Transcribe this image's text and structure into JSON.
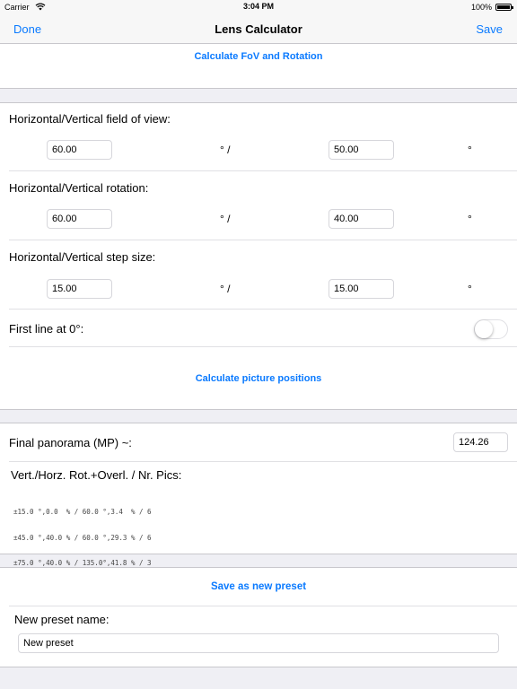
{
  "status": {
    "carrier": "Carrier",
    "time": "3:04 PM",
    "battery": "100%"
  },
  "nav": {
    "left": "Done",
    "title": "Lens Calculator",
    "right": "Save"
  },
  "actions": {
    "calc_fov": "Calculate FoV and Rotation",
    "calc_positions": "Calculate picture positions",
    "save_preset": "Save as new preset"
  },
  "fov": {
    "label": "Horizontal/Vertical field of view:",
    "h": "60.00",
    "v": "50.00"
  },
  "rotation": {
    "label": "Horizontal/Vertical rotation:",
    "h": "60.00",
    "v": "40.00"
  },
  "step": {
    "label": "Horizontal/Vertical step size:",
    "h": "15.00",
    "v": "15.00"
  },
  "units": {
    "sep": "° /",
    "end": "°"
  },
  "first_line": {
    "label": "First line at 0°:",
    "on": false
  },
  "panorama": {
    "label": "Final panorama (MP) ~:",
    "value": "124.26"
  },
  "results": {
    "header": "Vert./Horz. Rot.+Overl. / Nr. Pics:",
    "lines": [
      "±15.0 °,0.0  % / 60.0 °,3.4  % / 6",
      "±45.0 °,40.0 % / 60.0 °,29.3 % / 6",
      "±75.0 °,40.0 % / 135.0°,41.8 % / 3"
    ]
  },
  "preset": {
    "label": "New preset name:",
    "value": "New preset"
  },
  "colors": {
    "accent": "#0a7aff",
    "background": "#efeff4",
    "separator": "#c8c7cc"
  }
}
